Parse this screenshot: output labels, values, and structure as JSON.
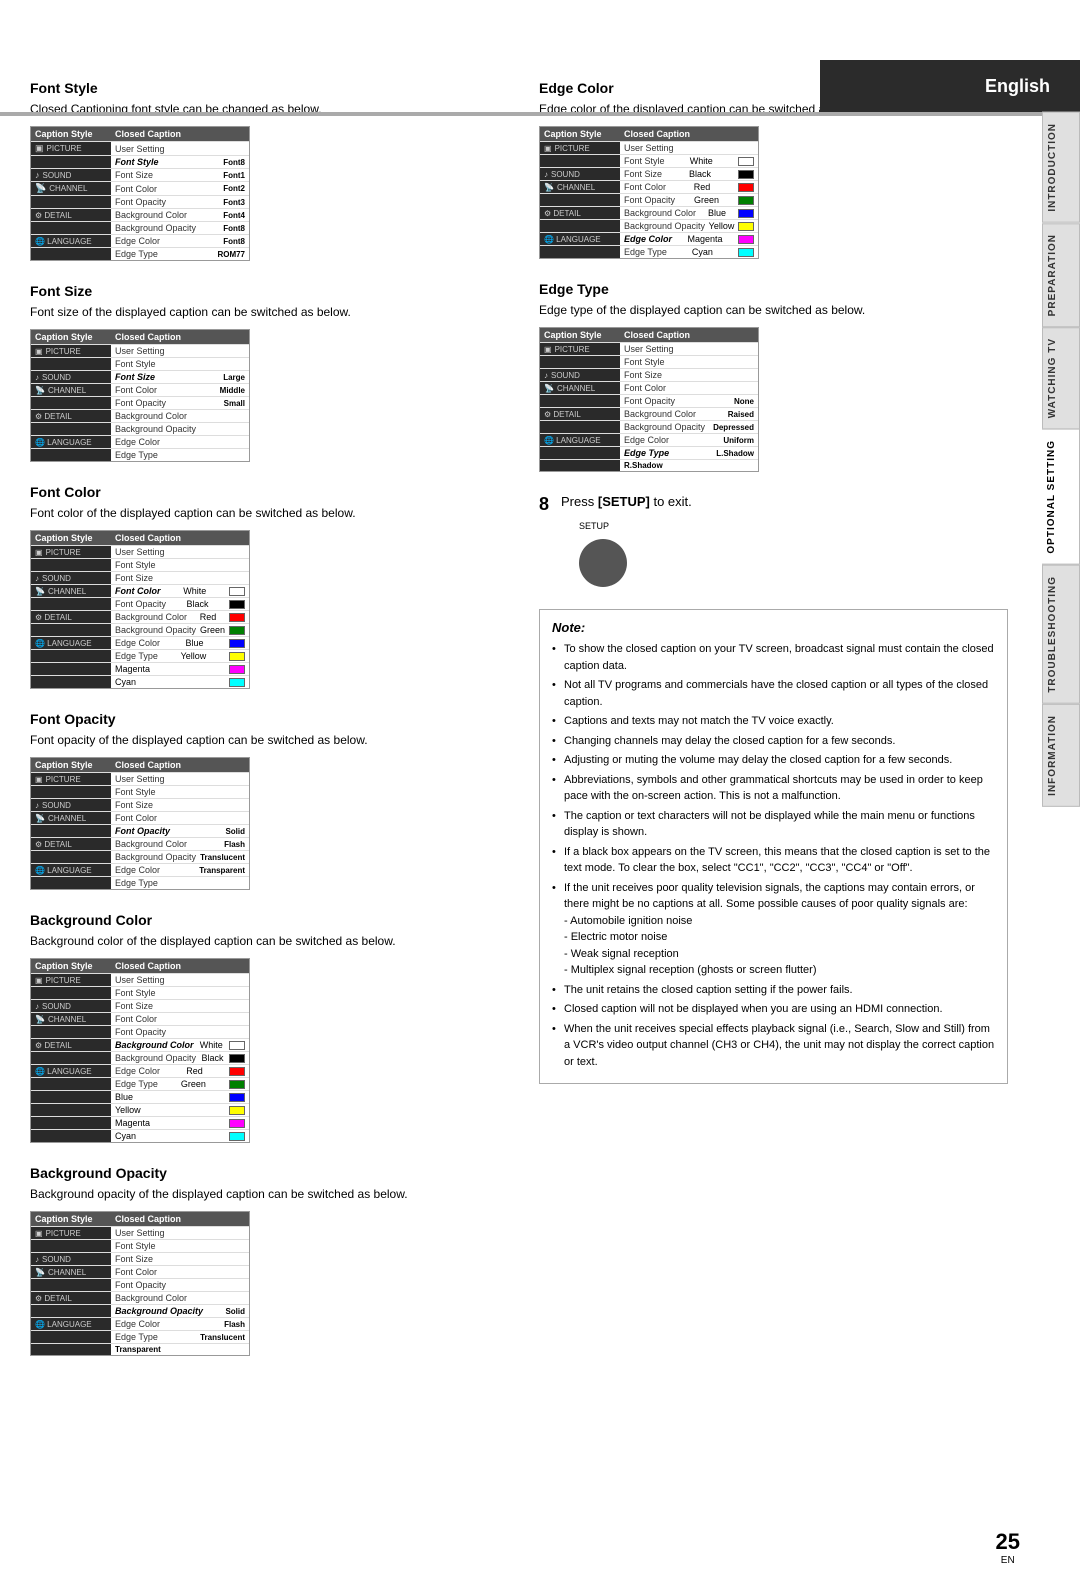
{
  "header": {
    "language_label": "English"
  },
  "right_tabs": [
    {
      "label": "INTRODUCTION",
      "active": false
    },
    {
      "label": "PREPARATION",
      "active": false
    },
    {
      "label": "WATCHING TV",
      "active": false
    },
    {
      "label": "OPTIONAL SETTING",
      "active": true
    },
    {
      "label": "TROUBLESHOOTING",
      "active": false
    },
    {
      "label": "INFORMATION",
      "active": false
    }
  ],
  "sections_left": [
    {
      "id": "font-style",
      "title": "Font Style",
      "desc": "Closed Captioning font style can be changed as below.",
      "menu": {
        "col1": "Caption Style",
        "col2": "Closed Caption",
        "rows": [
          {
            "left": "PICTURE",
            "name": "User Setting",
            "value": "",
            "swatch": null,
            "bold": false
          },
          {
            "left": "",
            "name": "Font Style",
            "value": "Font8",
            "swatch": null,
            "bold": true
          },
          {
            "left": "SOUND",
            "name": "Font Size",
            "value": "Font1",
            "swatch": null,
            "bold": false
          },
          {
            "left": "CHANNEL",
            "name": "Font Color",
            "value": "Font2",
            "swatch": null,
            "bold": false
          },
          {
            "left": "",
            "name": "Font Opacity",
            "value": "Font3",
            "swatch": null,
            "bold": false
          },
          {
            "left": "DETAIL",
            "name": "Background Color",
            "value": "Font4",
            "swatch": null,
            "bold": false
          },
          {
            "left": "",
            "name": "Background Opacity",
            "value": "Font8",
            "swatch": null,
            "bold": false
          },
          {
            "left": "LANGUAGE",
            "name": "Edge Color",
            "value": "Font8",
            "swatch": null,
            "bold": false
          },
          {
            "left": "",
            "name": "Edge Type",
            "value": "ROM77",
            "swatch": null,
            "bold": false
          }
        ]
      }
    },
    {
      "id": "font-size",
      "title": "Font Size",
      "desc": "Font size of the displayed caption can be switched as below.",
      "menu": {
        "col1": "Caption Style",
        "col2": "Closed Caption",
        "rows": [
          {
            "left": "PICTURE",
            "name": "User Setting",
            "value": "",
            "swatch": null,
            "bold": false
          },
          {
            "left": "",
            "name": "Font Style",
            "value": "",
            "swatch": null,
            "bold": false
          },
          {
            "left": "SOUND",
            "name": "Font Size",
            "value": "Large",
            "swatch": null,
            "bold": true
          },
          {
            "left": "CHANNEL",
            "name": "Font Color",
            "value": "Middle",
            "swatch": null,
            "bold": false
          },
          {
            "left": "",
            "name": "Font Opacity",
            "value": "Small",
            "swatch": null,
            "bold": false
          },
          {
            "left": "DETAIL",
            "name": "Background Color",
            "value": "",
            "swatch": null,
            "bold": false
          },
          {
            "left": "",
            "name": "Background Opacity",
            "value": "",
            "swatch": null,
            "bold": false
          },
          {
            "left": "LANGUAGE",
            "name": "Edge Color",
            "value": "",
            "swatch": null,
            "bold": false
          },
          {
            "left": "",
            "name": "Edge Type",
            "value": "",
            "swatch": null,
            "bold": false
          }
        ]
      }
    },
    {
      "id": "font-color",
      "title": "Font Color",
      "desc": "Font color of the displayed caption can be switched as below.",
      "menu": {
        "col1": "Caption Style",
        "col2": "Closed Caption",
        "rows": [
          {
            "left": "PICTURE",
            "name": "User Setting",
            "value": "",
            "swatch": null,
            "bold": false
          },
          {
            "left": "",
            "name": "Font Style",
            "value": "",
            "swatch": null,
            "bold": false
          },
          {
            "left": "SOUND",
            "name": "Font Size",
            "value": "",
            "swatch": null,
            "bold": false
          },
          {
            "left": "CHANNEL",
            "name": "Font Color",
            "value": "White",
            "swatch": "white",
            "bold": true
          },
          {
            "left": "",
            "name": "Font Opacity",
            "value": "Black",
            "swatch": "black",
            "bold": false
          },
          {
            "left": "DETAIL",
            "name": "Background Color",
            "value": "Red",
            "swatch": "red",
            "bold": false
          },
          {
            "left": "",
            "name": "Background Opacity",
            "value": "Green",
            "swatch": "green",
            "bold": false
          },
          {
            "left": "LANGUAGE",
            "name": "Edge Color",
            "value": "Blue",
            "swatch": "blue",
            "bold": false
          },
          {
            "left": "",
            "name": "Edge Type",
            "value": "Yellow",
            "swatch": "yellow",
            "bold": false
          },
          {
            "left": "",
            "name": "",
            "value": "Magenta",
            "swatch": "magenta",
            "bold": false
          },
          {
            "left": "",
            "name": "",
            "value": "Cyan",
            "swatch": "cyan",
            "bold": false
          }
        ]
      }
    },
    {
      "id": "font-opacity",
      "title": "Font Opacity",
      "desc": "Font opacity of the displayed caption can be switched as below.",
      "menu": {
        "col1": "Caption Style",
        "col2": "Closed Caption",
        "rows": [
          {
            "left": "PICTURE",
            "name": "User Setting",
            "value": "",
            "swatch": null,
            "bold": false
          },
          {
            "left": "",
            "name": "Font Style",
            "value": "",
            "swatch": null,
            "bold": false
          },
          {
            "left": "SOUND",
            "name": "Font Size",
            "value": "",
            "swatch": null,
            "bold": false
          },
          {
            "left": "CHANNEL",
            "name": "Font Color",
            "value": "",
            "swatch": null,
            "bold": false
          },
          {
            "left": "",
            "name": "Font Opacity",
            "value": "Solid",
            "swatch": null,
            "bold": true
          },
          {
            "left": "DETAIL",
            "name": "Background Color",
            "value": "Flash",
            "swatch": null,
            "bold": false
          },
          {
            "left": "",
            "name": "Background Opacity",
            "value": "Translucent",
            "swatch": null,
            "bold": false
          },
          {
            "left": "LANGUAGE",
            "name": "Edge Color",
            "value": "Transparent",
            "swatch": null,
            "bold": false
          },
          {
            "left": "",
            "name": "Edge Type",
            "value": "",
            "swatch": null,
            "bold": false
          }
        ]
      }
    },
    {
      "id": "background-color",
      "title": "Background Color",
      "desc": "Background color of the displayed caption can be switched as below.",
      "menu": {
        "col1": "Caption Style",
        "col2": "Closed Caption",
        "rows": [
          {
            "left": "PICTURE",
            "name": "User Setting",
            "value": "",
            "swatch": null,
            "bold": false
          },
          {
            "left": "",
            "name": "Font Style",
            "value": "",
            "swatch": null,
            "bold": false
          },
          {
            "left": "SOUND",
            "name": "Font Size",
            "value": "",
            "swatch": null,
            "bold": false
          },
          {
            "left": "CHANNEL",
            "name": "Font Color",
            "value": "",
            "swatch": null,
            "bold": false
          },
          {
            "left": "",
            "name": "Font Opacity",
            "value": "",
            "swatch": null,
            "bold": false
          },
          {
            "left": "DETAIL",
            "name": "Background Color",
            "value": "White",
            "swatch": "white",
            "bold": true
          },
          {
            "left": "",
            "name": "Background Opacity",
            "value": "Black",
            "swatch": "black",
            "bold": false
          },
          {
            "left": "LANGUAGE",
            "name": "Edge Color",
            "value": "Red",
            "swatch": "red",
            "bold": false
          },
          {
            "left": "",
            "name": "Edge Type",
            "value": "Green",
            "swatch": "green",
            "bold": false
          },
          {
            "left": "",
            "name": "",
            "value": "Blue",
            "swatch": "blue",
            "bold": false
          },
          {
            "left": "",
            "name": "",
            "value": "Yellow",
            "swatch": "yellow",
            "bold": false
          },
          {
            "left": "",
            "name": "",
            "value": "Magenta",
            "swatch": "magenta",
            "bold": false
          },
          {
            "left": "",
            "name": "",
            "value": "Cyan",
            "swatch": "cyan",
            "bold": false
          }
        ]
      }
    },
    {
      "id": "background-opacity",
      "title": "Background Opacity",
      "desc": "Background opacity of the displayed caption can be switched as below.",
      "menu": {
        "col1": "Caption Style",
        "col2": "Closed Caption",
        "rows": [
          {
            "left": "PICTURE",
            "name": "User Setting",
            "value": "",
            "swatch": null,
            "bold": false
          },
          {
            "left": "",
            "name": "Font Style",
            "value": "",
            "swatch": null,
            "bold": false
          },
          {
            "left": "SOUND",
            "name": "Font Size",
            "value": "",
            "swatch": null,
            "bold": false
          },
          {
            "left": "CHANNEL",
            "name": "Font Color",
            "value": "",
            "swatch": null,
            "bold": false
          },
          {
            "left": "",
            "name": "Font Opacity",
            "value": "",
            "swatch": null,
            "bold": false
          },
          {
            "left": "DETAIL",
            "name": "Background Color",
            "value": "",
            "swatch": null,
            "bold": false
          },
          {
            "left": "",
            "name": "Background Opacity",
            "value": "Solid",
            "swatch": null,
            "bold": true
          },
          {
            "left": "LANGUAGE",
            "name": "Edge Color",
            "value": "Flash",
            "swatch": null,
            "bold": false
          },
          {
            "left": "",
            "name": "Edge Type",
            "value": "Translucent",
            "swatch": null,
            "bold": false
          },
          {
            "left": "",
            "name": "",
            "value": "Transparent",
            "swatch": null,
            "bold": false
          }
        ]
      }
    }
  ],
  "sections_right": [
    {
      "id": "edge-color",
      "title": "Edge Color",
      "desc": "Edge color of the displayed caption can be switched as below.",
      "menu": {
        "col1": "Caption Style",
        "col2": "Closed Caption",
        "rows": [
          {
            "left": "PICTURE",
            "name": "User Setting",
            "value": "",
            "swatch": null,
            "bold": false
          },
          {
            "left": "",
            "name": "Font Style",
            "value": "White",
            "swatch": "white",
            "bold": false
          },
          {
            "left": "SOUND",
            "name": "Font Size",
            "value": "Black",
            "swatch": "black",
            "bold": false
          },
          {
            "left": "CHANNEL",
            "name": "Font Color",
            "value": "Red",
            "swatch": "red",
            "bold": false
          },
          {
            "left": "",
            "name": "Font Opacity",
            "value": "Green",
            "swatch": "green",
            "bold": false
          },
          {
            "left": "DETAIL",
            "name": "Background Color",
            "value": "Blue",
            "swatch": "blue",
            "bold": false
          },
          {
            "left": "",
            "name": "Background Opacity",
            "value": "Yellow",
            "swatch": "yellow",
            "bold": false
          },
          {
            "left": "LANGUAGE",
            "name": "Edge Color",
            "value": "Magenta",
            "swatch": "magenta",
            "bold": true
          },
          {
            "left": "",
            "name": "Edge Type",
            "value": "Cyan",
            "swatch": "cyan",
            "bold": false
          }
        ]
      }
    },
    {
      "id": "edge-type",
      "title": "Edge Type",
      "desc": "Edge type of the displayed caption can be switched as below.",
      "menu": {
        "col1": "Caption Style",
        "col2": "Closed Caption",
        "rows": [
          {
            "left": "PICTURE",
            "name": "User Setting",
            "value": "",
            "swatch": null,
            "bold": false
          },
          {
            "left": "",
            "name": "Font Style",
            "value": "",
            "swatch": null,
            "bold": false
          },
          {
            "left": "SOUND",
            "name": "Font Size",
            "value": "",
            "swatch": null,
            "bold": false
          },
          {
            "left": "CHANNEL",
            "name": "Font Color",
            "value": "",
            "swatch": null,
            "bold": false
          },
          {
            "left": "",
            "name": "Font Opacity",
            "value": "None",
            "swatch": null,
            "bold": false
          },
          {
            "left": "DETAIL",
            "name": "Background Color",
            "value": "Raised",
            "swatch": null,
            "bold": false
          },
          {
            "left": "",
            "name": "Background Opacity",
            "value": "Depressed",
            "swatch": null,
            "bold": false
          },
          {
            "left": "LANGUAGE",
            "name": "Edge Color",
            "value": "Uniform",
            "swatch": null,
            "bold": false
          },
          {
            "left": "",
            "name": "Edge Type",
            "value": "L.Shadow",
            "swatch": null,
            "bold": true
          },
          {
            "left": "",
            "name": "",
            "value": "R.Shadow",
            "swatch": null,
            "bold": false
          }
        ]
      }
    }
  ],
  "step8": {
    "number": "8",
    "text": "Press",
    "bold_text": "[SETUP]",
    "text2": "to exit.",
    "button_label": "SETUP"
  },
  "note": {
    "title": "Note:",
    "items": [
      "To show the closed caption on your TV screen, broadcast signal must contain the closed caption data.",
      "Not all TV programs and commercials have the closed caption or all types of the closed caption.",
      "Captions and texts may not match the TV voice exactly.",
      "Changing channels may delay the closed caption for a few seconds.",
      "Adjusting or muting the volume may delay the closed caption for a few seconds.",
      "Abbreviations, symbols and other grammatical shortcuts may be used in order to keep pace with the on-screen action. This is not a malfunction.",
      "The caption or text characters will not be displayed while the main menu or functions display is shown.",
      "If a black box appears on the TV screen, this means that the closed caption is set to the text mode. To clear the box, select \"CC1\", \"CC2\", \"CC3\", \"CC4\" or \"Off\".",
      "If the unit receives poor quality television signals, the captions may contain errors, or there might be no captions at all. Some possible causes of poor quality signals are:\n- Automobile ignition noise\n- Electric motor noise\n- Weak signal reception\n- Multiplex signal reception (ghosts or screen flutter)",
      "The unit retains the closed caption setting if the power fails.",
      "Closed caption will not be displayed when you are using an HDMI connection.",
      "When the unit receives special effects playback signal (i.e., Search, Slow and Still) from a VCR's video output channel (CH3 or CH4), the unit may not display the correct caption or text."
    ]
  },
  "footer": {
    "page_number": "25",
    "lang": "EN"
  }
}
